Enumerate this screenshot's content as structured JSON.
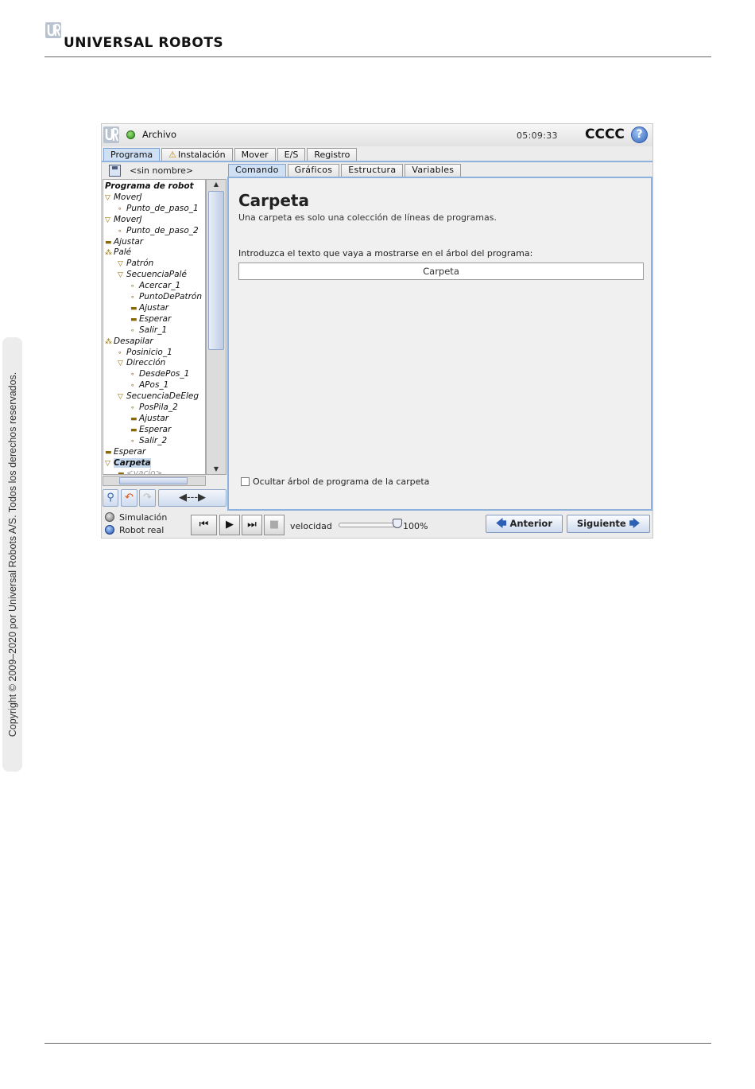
{
  "page": {
    "brand": "UNIVERSAL ROBOTS",
    "copyright": "Copyright © 2009–2020 por Universal Robots A/S. Todos los derechos reservados."
  },
  "app": {
    "file_menu": "Archivo",
    "clock": "05:09:33",
    "robot_name": "CCCC",
    "help_symbol": "?",
    "main_tabs": [
      {
        "label": "Programa",
        "active": true
      },
      {
        "label": "Instalación",
        "warning": true
      },
      {
        "label": "Mover"
      },
      {
        "label": "E/S"
      },
      {
        "label": "Registro"
      }
    ],
    "program_name": "<sin nombre>",
    "tree": [
      {
        "label": "Programa de robot",
        "depth": 0,
        "icon": "",
        "header": true
      },
      {
        "label": "MoverJ",
        "depth": 0,
        "icon": "▽"
      },
      {
        "label": "Punto_de_paso_1",
        "depth": 1,
        "icon": "∘"
      },
      {
        "label": "MoverJ",
        "depth": 0,
        "icon": "▽"
      },
      {
        "label": "Punto_de_paso_2",
        "depth": 1,
        "icon": "∘"
      },
      {
        "label": "Ajustar",
        "depth": 0,
        "icon": "▬"
      },
      {
        "label": "Palé",
        "depth": 0,
        "icon": "⁂"
      },
      {
        "label": "Patrón",
        "depth": 1,
        "icon": "▽"
      },
      {
        "label": "SecuenciaPalé",
        "depth": 1,
        "icon": "▽"
      },
      {
        "label": "Acercar_1",
        "depth": 2,
        "icon": "∘"
      },
      {
        "label": "PuntoDePatrón",
        "depth": 2,
        "icon": "∘"
      },
      {
        "label": "Ajustar",
        "depth": 2,
        "icon": "▬"
      },
      {
        "label": "Esperar",
        "depth": 2,
        "icon": "▬"
      },
      {
        "label": "Salir_1",
        "depth": 2,
        "icon": "∘"
      },
      {
        "label": "Desapilar",
        "depth": 0,
        "icon": "⁂"
      },
      {
        "label": "Posinicio_1",
        "depth": 1,
        "icon": "∘"
      },
      {
        "label": "Dirección",
        "depth": 1,
        "icon": "▽"
      },
      {
        "label": "DesdePos_1",
        "depth": 2,
        "icon": "∘"
      },
      {
        "label": "APos_1",
        "depth": 2,
        "icon": "∘"
      },
      {
        "label": "SecuenciaDeEleg",
        "depth": 1,
        "icon": "▽"
      },
      {
        "label": "PosPila_2",
        "depth": 2,
        "icon": "∘"
      },
      {
        "label": "Ajustar",
        "depth": 2,
        "icon": "▬"
      },
      {
        "label": "Esperar",
        "depth": 2,
        "icon": "▬"
      },
      {
        "label": "Salir_2",
        "depth": 2,
        "icon": "∘"
      },
      {
        "label": "Esperar",
        "depth": 0,
        "icon": "▬"
      },
      {
        "label": "Carpeta",
        "depth": 0,
        "icon": "▽",
        "selected": true
      },
      {
        "label": "<vacío>",
        "depth": 1,
        "icon": "▬",
        "empty": true
      }
    ],
    "sub_tabs": [
      {
        "label": "Comando",
        "active": true
      },
      {
        "label": "Gráficos"
      },
      {
        "label": "Estructura"
      },
      {
        "label": "Variables"
      }
    ],
    "content": {
      "title": "Carpeta",
      "description": "Una carpeta es solo una colección de líneas de programas.",
      "prompt": "Introduzca el texto que vaya a mostrarse en el árbol del programa:",
      "input_value": "Carpeta",
      "hide_tree_label": "Ocultar árbol de programa de la carpeta"
    },
    "modes": {
      "simulation": "Simulación",
      "real": "Robot real"
    },
    "speed_label": "velocidad",
    "speed_value": "100%",
    "speed_fraction": 1.0,
    "prev_label": "Anterior",
    "next_label": "Siguiente",
    "colors": {
      "accent": "#8fb2dc",
      "status_ok": "#2e8b18",
      "help": "#3465b8"
    }
  }
}
